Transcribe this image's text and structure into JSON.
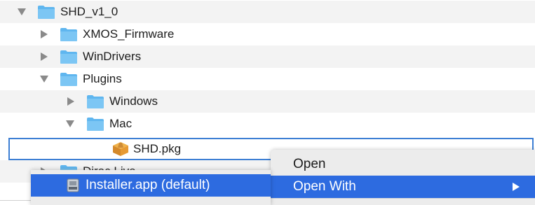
{
  "tree": {
    "root": "SHD_v1_0",
    "items": [
      {
        "label": "XMOS_Firmware"
      },
      {
        "label": "WinDrivers"
      },
      {
        "label": "Plugins"
      },
      {
        "label": "Windows"
      },
      {
        "label": "Mac"
      },
      {
        "label": "SHD.pkg"
      },
      {
        "label": "Dirac Live"
      }
    ]
  },
  "context_menu": {
    "items": [
      {
        "label": "Open"
      },
      {
        "label": "Open With"
      }
    ]
  },
  "submenu": {
    "items": [
      {
        "label": "Installer.app (default)"
      }
    ]
  },
  "colors": {
    "accent": "#2d6be0",
    "folder": "#5fb6ef",
    "selection_border": "#3d7fd4"
  }
}
